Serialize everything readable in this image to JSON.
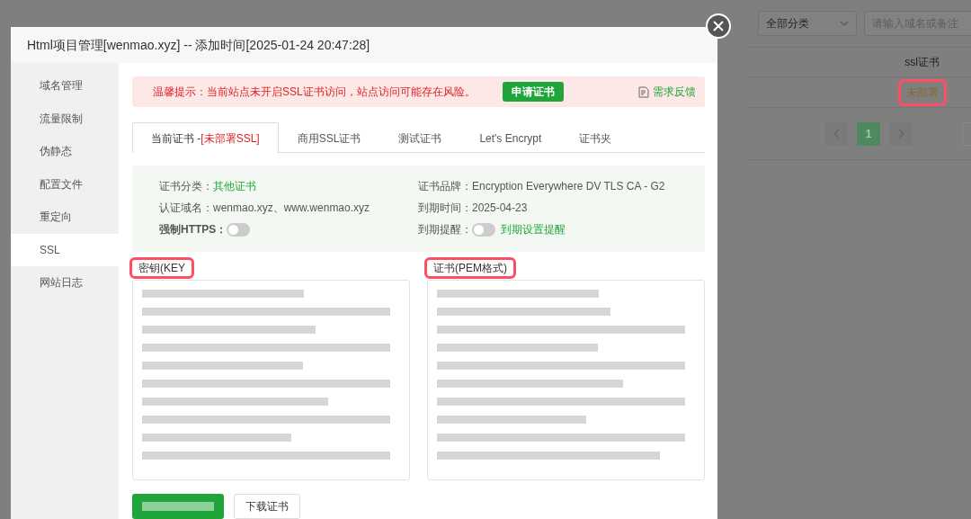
{
  "background_page": {
    "category_select": {
      "value": "全部分类"
    },
    "search": {
      "placeholder": "请输入域名或备注"
    },
    "table": {
      "columns": [
        "ssl证书"
      ],
      "rows": [
        {
          "ssl_status": "未部署",
          "highlighted": true
        }
      ]
    },
    "pagination": {
      "pages": [
        {
          "label": "1",
          "selected": true
        }
      ]
    }
  },
  "modal": {
    "title": "Html项目管理[wenmao.xyz] -- 添加时间[2025-01-24 20:47:28]",
    "sidebar": {
      "items": [
        {
          "label": "域名管理",
          "selected": false
        },
        {
          "label": "流量限制",
          "selected": false
        },
        {
          "label": "伪静态",
          "selected": false
        },
        {
          "label": "配置文件",
          "selected": false
        },
        {
          "label": "重定向",
          "selected": false
        },
        {
          "label": "SSL",
          "selected": true
        },
        {
          "label": "网站日志",
          "selected": false
        }
      ]
    },
    "alert": {
      "message": "温馨提示：当前站点未开启SSL证书访问，站点访问可能存在风险。",
      "button": "申请证书",
      "feedback": "需求反馈"
    },
    "tabs": [
      {
        "label": "当前证书 -",
        "status": "[未部署SSL]",
        "selected": true
      },
      {
        "label": "商用SSL证书",
        "selected": false
      },
      {
        "label": "测试证书",
        "selected": false
      },
      {
        "label": "Let's Encrypt",
        "selected": false
      },
      {
        "label": "证书夹",
        "selected": false
      }
    ],
    "info": {
      "category_label": "证书分类：",
      "category": "其他证书",
      "brand_label": "证书品牌：",
      "brand": "Encryption Everywhere DV TLS CA - G2",
      "domains_label": "认证域名：",
      "domains": "wenmao.xyz、www.wenmao.xyz",
      "expiry_label": "到期时间：",
      "expiry": "2025-04-23",
      "https_label": "强制HTTPS：",
      "https_on": false,
      "reminder_label": "到期提醒：",
      "reminder_on": false,
      "reminder_link": "到期设置提醒"
    },
    "key_field": {
      "label": "密钥(KEY",
      "highlighted": true
    },
    "cert_field": {
      "label": "证书(PEM格式)",
      "highlighted": true
    },
    "download_button": "下载证书"
  }
}
